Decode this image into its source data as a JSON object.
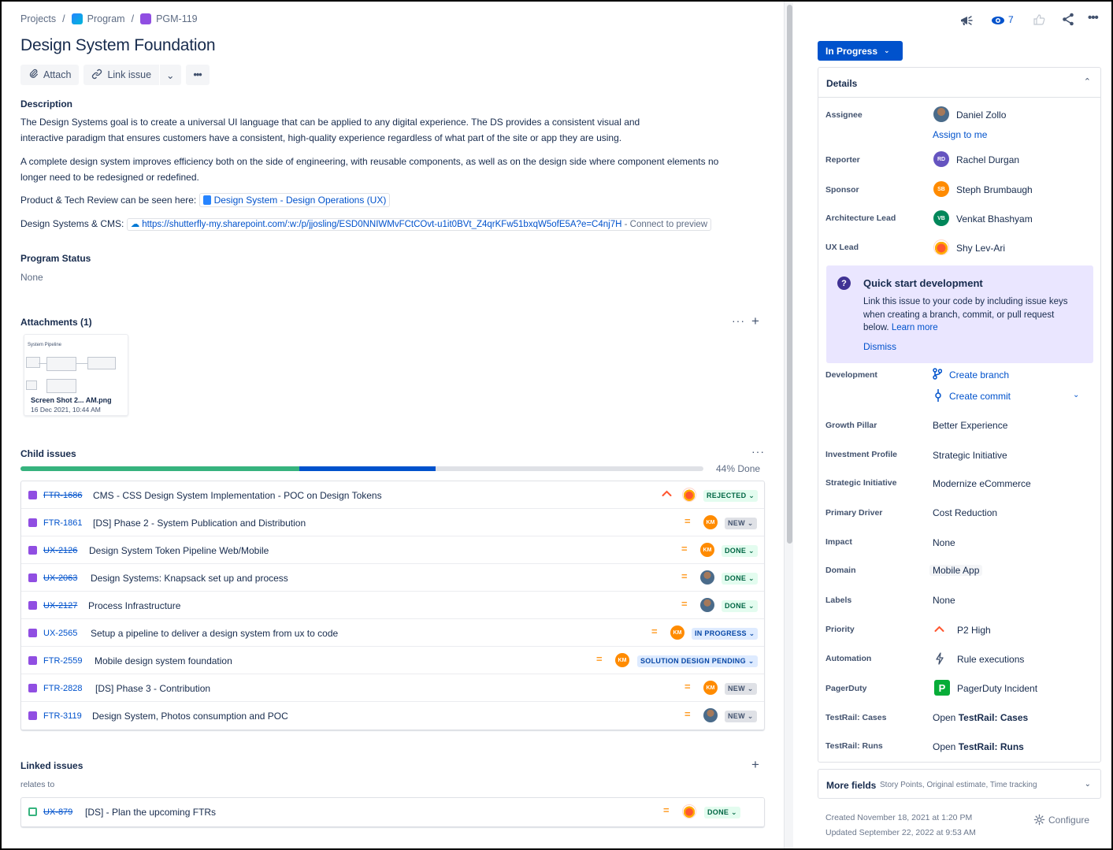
{
  "breadcrumb": {
    "projects": "Projects",
    "sep": "/",
    "program": "Program",
    "issue": "PGM-119"
  },
  "title": "Design System Foundation",
  "toolbar": {
    "attach": "Attach",
    "link_issue": "Link issue",
    "dropdown": "⌄",
    "more": "•••"
  },
  "description": {
    "heading": "Description",
    "p1_line1": "The Design Systems goal is to create a universal UI language that can be applied to any digital experience. The DS provides a consistent visual and",
    "p1_line2": "interactive paradigm that ensures customers have a consistent, high-quality experience regardless of what part of the site or app they are using.",
    "p2_line1": "A complete design system improves efficiency both on the side of engineering, with reusable components, as well as on the design side where component elements no",
    "p2_line2": "longer need to be redesigned or redefined.",
    "p3_prefix": "Product & Tech Review can be seen here:",
    "p3_link": "Design System - Design Operations (UX)",
    "p4_prefix": "Design Systems & CMS:",
    "p4_link": "https://shutterfly-my.sharepoint.com/:w:/p/jjosling/ESD0NNIWMvFCtCOvt-u1it0BVt_Z4qrKFw51bxqW5ofE5A?e=C4nj7H",
    "p4_suffix": "- Connect to preview"
  },
  "program_status": {
    "heading": "Program Status",
    "value": "None"
  },
  "attachments": {
    "heading": "Attachments (1)",
    "more": "···",
    "add": "+",
    "file": {
      "thumb_title": "System Pipeline",
      "name": "Screen Shot 2...   AM.png",
      "date": "16 Dec 2021, 10:44 AM"
    }
  },
  "child_issues": {
    "heading": "Child issues",
    "more": "···",
    "progress_done_pct": 44,
    "progress_done_fraction": 0.408,
    "progress_inprogress_fraction": 0.2,
    "progress_label": "44% Done",
    "rows": [
      {
        "key": "FTR-1686",
        "strike": true,
        "summary": "CMS - CSS Design System Implementation - POC on Design Tokens",
        "priority": "^",
        "avatar": "",
        "status": "REJECTED ⌄"
      },
      {
        "key": "FTR-1861",
        "strike": false,
        "summary": "[DS] Phase 2 - System Publication and Distribution",
        "priority": "=",
        "avatar": "KM",
        "status": "NEW ⌄"
      },
      {
        "key": "UX-2126",
        "strike": true,
        "summary": "Design System Token Pipeline Web/Mobile",
        "priority": "=",
        "avatar": "KM",
        "status": "DONE ⌄"
      },
      {
        "key": "UX-2063",
        "strike": true,
        "summary": "Design Systems: Knapsack set up and process",
        "priority": "=",
        "avatar": "",
        "status": "DONE ⌄"
      },
      {
        "key": "UX-2127",
        "strike": true,
        "summary": "Process Infrastructure",
        "priority": "=",
        "avatar": "",
        "status": "DONE ⌄"
      },
      {
        "key": "UX-2565",
        "strike": false,
        "summary": "Setup a pipeline to deliver a design system from ux to code",
        "priority": "=",
        "avatar": "KM",
        "status": "IN PROGRESS ⌄"
      },
      {
        "key": "FTR-2559",
        "strike": false,
        "summary": "Mobile design system foundation",
        "priority": "=",
        "avatar": "KM",
        "status": "SOLUTION DESIGN PENDING ⌄"
      },
      {
        "key": "FTR-2828",
        "strike": false,
        "summary": "[DS] Phase 3 - Contribution",
        "priority": "=",
        "avatar": "KM",
        "status": "NEW ⌄"
      },
      {
        "key": "FTR-3119",
        "strike": false,
        "summary": "Design System, Photos consumption and POC",
        "priority": "=",
        "avatar": "",
        "status": "NEW ⌄"
      }
    ]
  },
  "linked_issues": {
    "heading": "Linked issues",
    "add": "+",
    "relation": "relates to",
    "row": {
      "key": "UX-879",
      "summary": "[DS] - Plan the upcoming FTRs",
      "priority": "=",
      "status": "DONE ⌄"
    }
  },
  "right": {
    "watchers": "7",
    "status_button": "In Progress",
    "details_heading": "Details",
    "assignee": {
      "label": "Assignee",
      "name": "Daniel Zollo",
      "assign_me": "Assign to me"
    },
    "reporter": {
      "label": "Reporter",
      "initials": "RD",
      "name": "Rachel Durgan"
    },
    "sponsor": {
      "label": "Sponsor",
      "initials": "SB",
      "name": "Steph Brumbaugh"
    },
    "arch_lead": {
      "label": "Architecture Lead",
      "initials": "VB",
      "name": "Venkat Bhashyam"
    },
    "ux_lead": {
      "label": "UX Lead",
      "name": "Shy Lev-Ari"
    },
    "quick_start": {
      "icon": "?",
      "title": "Quick start development",
      "line1": "Link this issue to your code by including issue keys",
      "line2": "when creating a branch, commit, or pull request",
      "line3": "below.",
      "learn_more": "Learn more",
      "dismiss": "Dismiss"
    },
    "development": {
      "label": "Development",
      "create_branch": "Create branch",
      "create_commit": "Create commit"
    },
    "growth_pillar": {
      "label": "Growth Pillar",
      "value": "Better Experience"
    },
    "investment_profile": {
      "label": "Investment Profile",
      "value": "Strategic Initiative"
    },
    "strategic_initiative": {
      "label": "Strategic Initiative",
      "value": "Modernize eCommerce"
    },
    "primary_driver": {
      "label": "Primary Driver",
      "value": "Cost Reduction"
    },
    "impact": {
      "label": "Impact",
      "value": "None"
    },
    "domain": {
      "label": "Domain",
      "value": "Mobile App"
    },
    "labels": {
      "label": "Labels",
      "value": "None"
    },
    "priority": {
      "label": "Priority",
      "value": "P2 High"
    },
    "automation": {
      "label": "Automation",
      "value": "Rule executions"
    },
    "pagerduty": {
      "label": "PagerDuty",
      "icon": "P",
      "value": "PagerDuty Incident"
    },
    "testrail_cases": {
      "label": "TestRail: Cases",
      "prefix": "Open",
      "value": "TestRail: Cases"
    },
    "testrail_runs": {
      "label": "TestRail: Runs",
      "prefix": "Open",
      "value": "TestRail: Runs"
    },
    "more_fields": {
      "title": "More fields",
      "sub": "Story Points, Original estimate, Time tracking"
    },
    "created": "Created November 18, 2021 at 1:20 PM",
    "updated": "Updated September 22, 2022 at 9:53 AM",
    "configure": "Configure"
  },
  "colors": {
    "accent": "#0052cc",
    "done": "#36b37e",
    "epic": "#904ee2",
    "medium": "#ff991f",
    "high": "#ff5630"
  },
  "icons": [
    "attach-icon",
    "link-icon",
    "megaphone-icon",
    "eye-icon",
    "thumbs-up-icon",
    "share-icon",
    "more-icon",
    "branch-icon",
    "commit-icon",
    "lightning-icon",
    "gear-icon"
  ]
}
